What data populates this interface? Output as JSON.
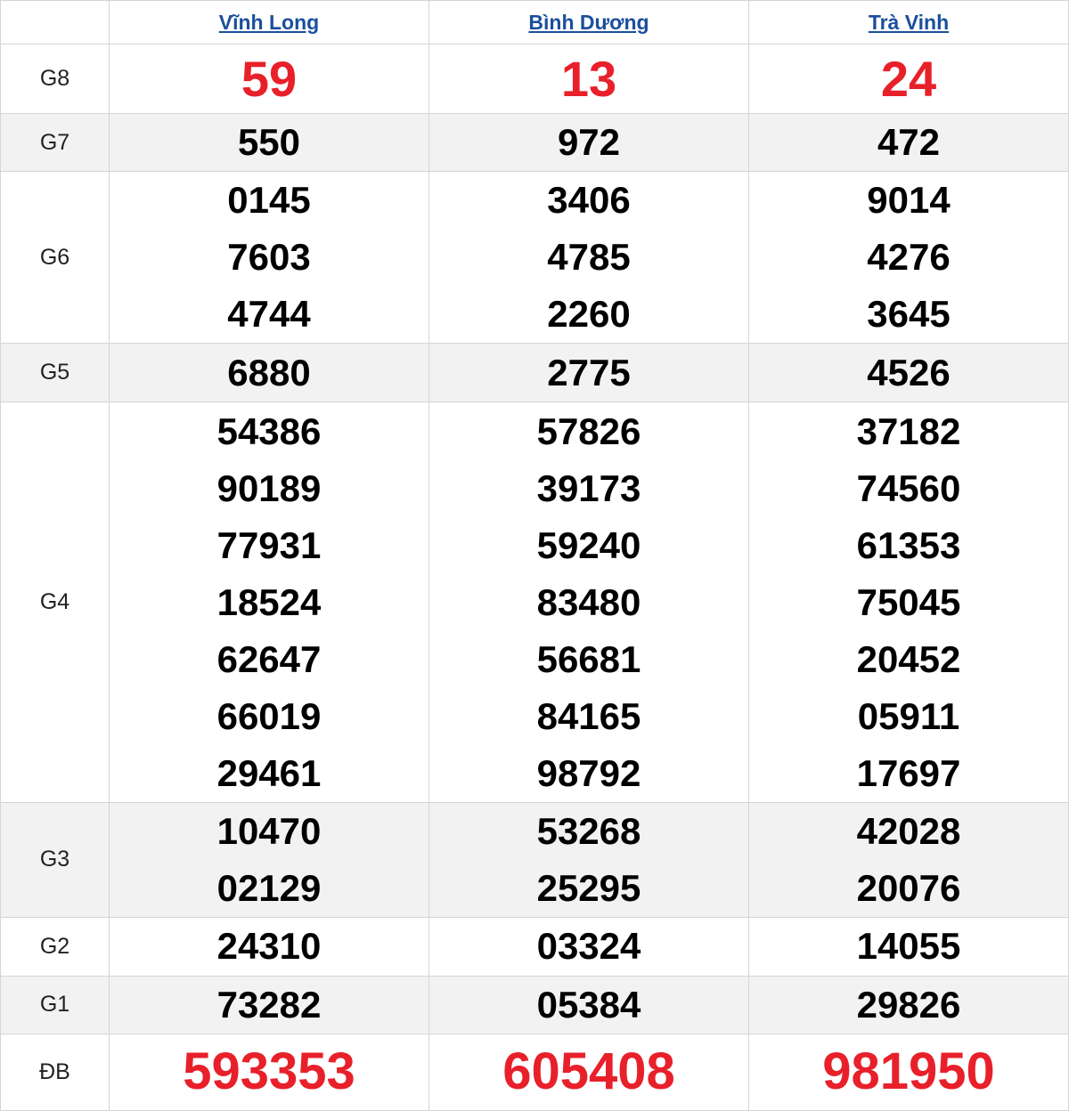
{
  "provinces": [
    "Vĩnh Long",
    "Bình Dương",
    "Trà Vinh"
  ],
  "prizes": {
    "G8": {
      "label": "G8",
      "values": [
        [
          "59"
        ],
        [
          "13"
        ],
        [
          "24"
        ]
      ]
    },
    "G7": {
      "label": "G7",
      "values": [
        [
          "550"
        ],
        [
          "972"
        ],
        [
          "472"
        ]
      ]
    },
    "G6": {
      "label": "G6",
      "values": [
        [
          "0145",
          "7603",
          "4744"
        ],
        [
          "3406",
          "4785",
          "2260"
        ],
        [
          "9014",
          "4276",
          "3645"
        ]
      ]
    },
    "G5": {
      "label": "G5",
      "values": [
        [
          "6880"
        ],
        [
          "2775"
        ],
        [
          "4526"
        ]
      ]
    },
    "G4": {
      "label": "G4",
      "values": [
        [
          "54386",
          "90189",
          "77931",
          "18524",
          "62647",
          "66019",
          "29461"
        ],
        [
          "57826",
          "39173",
          "59240",
          "83480",
          "56681",
          "84165",
          "98792"
        ],
        [
          "37182",
          "74560",
          "61353",
          "75045",
          "20452",
          "05911",
          "17697"
        ]
      ]
    },
    "G3": {
      "label": "G3",
      "values": [
        [
          "10470",
          "02129"
        ],
        [
          "53268",
          "25295"
        ],
        [
          "42028",
          "20076"
        ]
      ]
    },
    "G2": {
      "label": "G2",
      "values": [
        [
          "24310"
        ],
        [
          "03324"
        ],
        [
          "14055"
        ]
      ]
    },
    "G1": {
      "label": "G1",
      "values": [
        [
          "73282"
        ],
        [
          "05384"
        ],
        [
          "29826"
        ]
      ]
    },
    "DB": {
      "label": "ĐB",
      "values": [
        [
          "593353"
        ],
        [
          "605408"
        ],
        [
          "981950"
        ]
      ]
    }
  },
  "colors": {
    "header_link": "#1a4f9c",
    "highlight": "#e8202a",
    "row_alt": "#f2f2f2",
    "border": "#d5d5d5"
  }
}
